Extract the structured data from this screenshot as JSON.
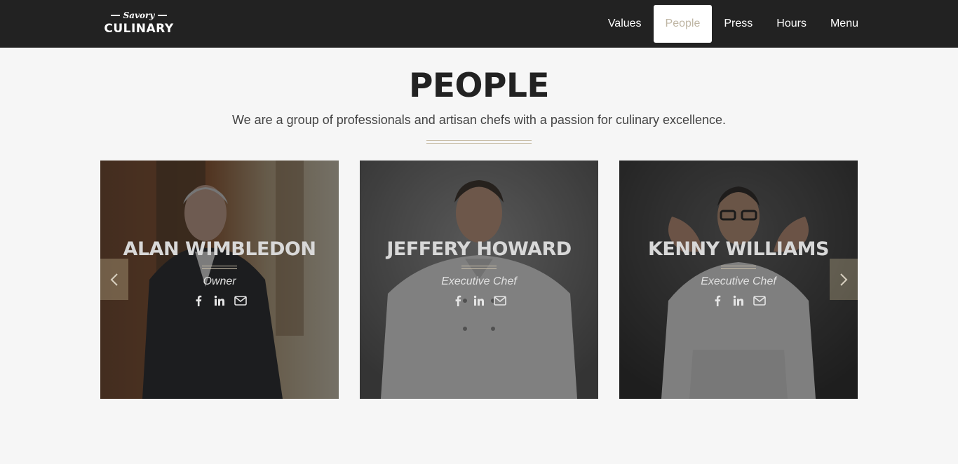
{
  "brand": {
    "top": "Savory",
    "bottom": "CULINARY"
  },
  "nav": {
    "items": [
      {
        "label": "Values"
      },
      {
        "label": "People"
      },
      {
        "label": "Press"
      },
      {
        "label": "Hours"
      },
      {
        "label": "Menu"
      }
    ],
    "active": "People"
  },
  "section": {
    "title": "PEOPLE",
    "subtitle": "We are a group of professionals and artisan chefs with a passion for culinary excellence."
  },
  "people": [
    {
      "name": "ALAN WIMBLEDON",
      "role": "Owner"
    },
    {
      "name": "JEFFERY HOWARD",
      "role": "Executive Chef"
    },
    {
      "name": "KENNY WILLIAMS",
      "role": "Executive Chef"
    }
  ],
  "social_icons": [
    "facebook-icon",
    "linkedin-icon",
    "email-icon"
  ],
  "colors": {
    "topbar": "#222222",
    "accent": "#c9bea8",
    "active_text": "#bfb6a4"
  }
}
